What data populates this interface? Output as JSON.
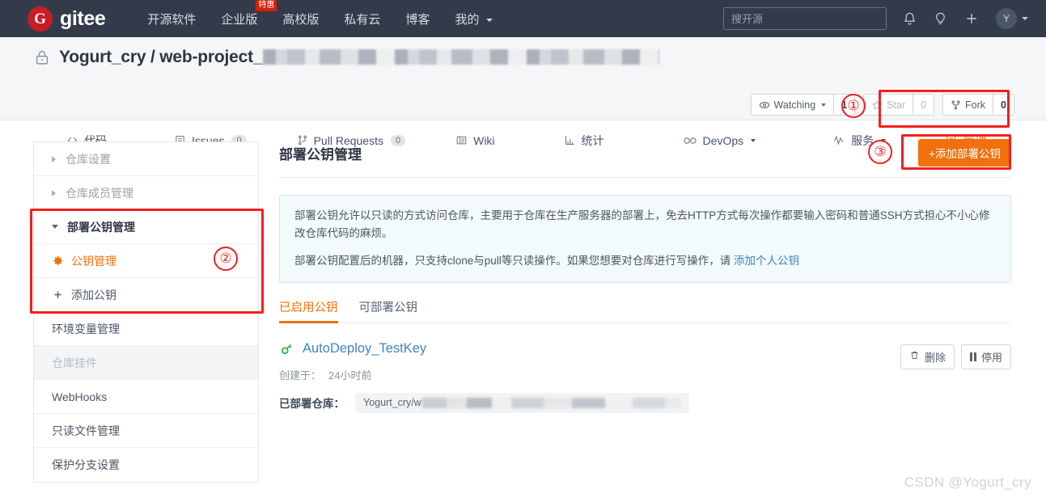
{
  "topnav": {
    "brand_initial": "G",
    "brand_name": "gitee",
    "links": [
      {
        "label": "开源软件",
        "badge": null,
        "caret": false
      },
      {
        "label": "企业版",
        "badge": "特惠",
        "caret": false
      },
      {
        "label": "高校版",
        "badge": null,
        "caret": false
      },
      {
        "label": "私有云",
        "badge": null,
        "caret": false
      },
      {
        "label": "博客",
        "badge": null,
        "caret": false
      },
      {
        "label": "我的",
        "badge": null,
        "caret": true
      }
    ],
    "search_placeholder": "搜开源",
    "search_value": "",
    "icons": [
      "bell-icon",
      "lightbulb-icon",
      "plus-icon"
    ],
    "avatar_initial": "Y"
  },
  "repo": {
    "owner": "Yogurt_cry",
    "separator": "/",
    "name": "web-project_",
    "name_redacted": true,
    "watching_label": "Watching",
    "watching_count": "1",
    "star_label": "Star",
    "star_count": "0",
    "fork_label": "Fork",
    "fork_count": "0",
    "tabs": [
      {
        "label": "代码",
        "icon": "code-icon",
        "count": null,
        "caret": false,
        "active": false
      },
      {
        "label": "Issues",
        "icon": "issue-icon",
        "count": "0",
        "caret": false,
        "active": false
      },
      {
        "label": "Pull Requests",
        "icon": "pr-icon",
        "count": "0",
        "caret": false,
        "active": false
      },
      {
        "label": "Wiki",
        "icon": "wiki-icon",
        "count": null,
        "caret": false,
        "active": false
      },
      {
        "label": "统计",
        "icon": "chart-icon",
        "count": null,
        "caret": false,
        "active": false
      },
      {
        "label": "DevOps",
        "icon": "infinity-icon",
        "count": null,
        "caret": true,
        "active": false
      },
      {
        "label": "服务",
        "icon": "pulse-icon",
        "count": null,
        "caret": true,
        "active": false
      },
      {
        "label": "管理",
        "icon": "manage-icon",
        "count": null,
        "caret": false,
        "active": true
      }
    ]
  },
  "sidebar": {
    "items": [
      {
        "label": "仓库设置",
        "marker": "tri-right",
        "state": "gray"
      },
      {
        "label": "仓库成员管理",
        "marker": "tri-right",
        "state": "gray"
      },
      {
        "label": "部署公钥管理",
        "marker": "tri-down",
        "state": "head"
      },
      {
        "label": "公钥管理",
        "marker": "gear-icon",
        "state": "active"
      },
      {
        "label": "添加公钥",
        "marker": "plus-icon",
        "state": "normal"
      },
      {
        "label": "环境变量管理",
        "marker": "none",
        "state": "normal"
      },
      {
        "label": "仓库挂件",
        "marker": "none",
        "state": "disabled"
      },
      {
        "label": "WebHooks",
        "marker": "none",
        "state": "normal"
      },
      {
        "label": "只读文件管理",
        "marker": "none",
        "state": "normal"
      },
      {
        "label": "保护分支设置",
        "marker": "none",
        "state": "normal"
      }
    ]
  },
  "main": {
    "title": "部署公钥管理",
    "add_button": "+添加部署公钥",
    "info": {
      "p1": "部署公钥允许以只读的方式访问仓库，主要用于仓库在生产服务器的部署上，免去HTTP方式每次操作都要输入密码和普通SSH方式担心不小心修改仓库代码的麻烦。",
      "p2_prefix": "部署公钥配置后的机器，只支持clone与pull等只读操作。如果您想要对仓库进行写操作，请 ",
      "p2_link": "添加个人公钥"
    },
    "tabs": [
      {
        "label": "已启用公钥",
        "active": true
      },
      {
        "label": "可部署公钥",
        "active": false
      }
    ],
    "key": {
      "name": "AutoDeploy_TestKey",
      "created_label": "创建于：",
      "created_value": "24小时前",
      "repo_label": "已部署仓库：",
      "repo_value": "Yogurt_cry/w",
      "repo_value_redacted": true,
      "delete_button": "删除",
      "disable_button": "停用"
    }
  },
  "annotations": [
    {
      "id": "①",
      "target": "manage-tab"
    },
    {
      "id": "②",
      "target": "sidebar-deploy-key-section"
    },
    {
      "id": "③",
      "target": "add-deploy-key-button"
    }
  ],
  "watermark": "CSDN @Yogurt_cry",
  "colors": {
    "navbar_bg": "#333b4b",
    "brand_red": "#c71d23",
    "accent_orange": "#f1700c",
    "link_blue": "#4183c4",
    "annotation_red": "#f41f1f",
    "key_green": "#2cb34a",
    "info_bg": "#f2fafb"
  }
}
